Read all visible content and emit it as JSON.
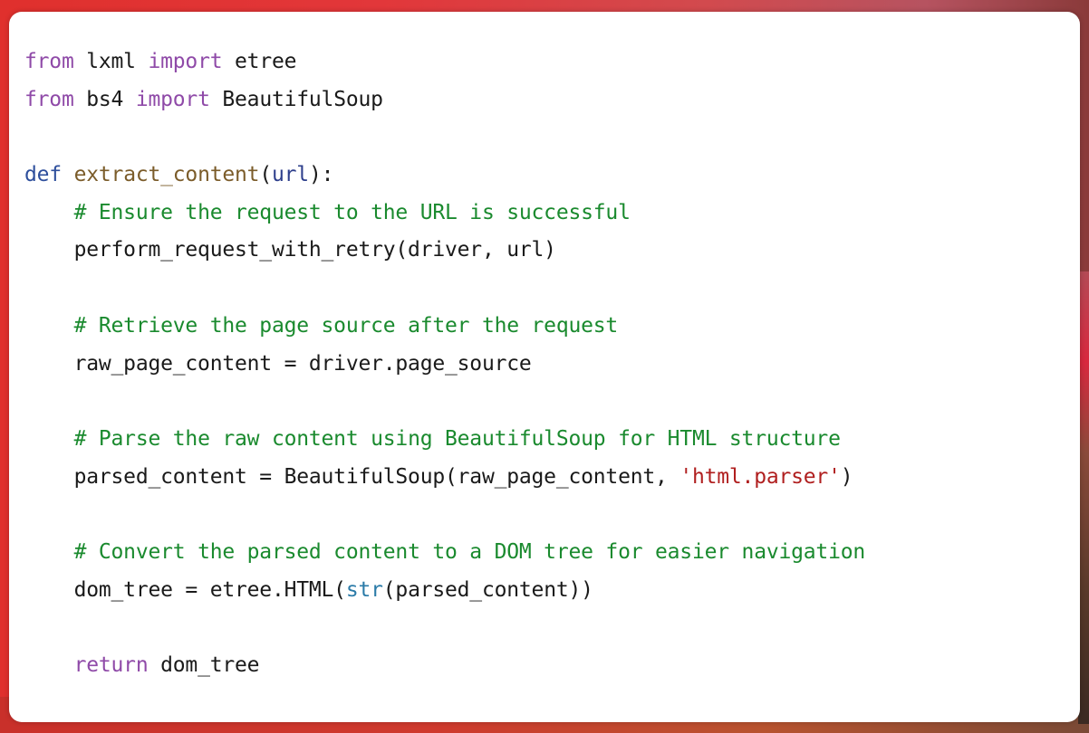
{
  "colors": {
    "keyword": "#8f4aa8",
    "def_keyword": "#2e4f9c",
    "function_name": "#7b5c2a",
    "parameter": "#2e3f8c",
    "comment": "#1a8a2e",
    "string": "#b01f1f",
    "builtin": "#2b7ba8",
    "text": "#1a1a1a",
    "card_background": "#ffffff",
    "page_background": "#e0302d"
  },
  "code": {
    "language": "python",
    "lines": [
      {
        "tokens": [
          {
            "t": "kw",
            "v": "from"
          },
          {
            "t": "plain",
            "v": " lxml "
          },
          {
            "t": "kw",
            "v": "import"
          },
          {
            "t": "plain",
            "v": " etree"
          }
        ]
      },
      {
        "tokens": [
          {
            "t": "kw",
            "v": "from"
          },
          {
            "t": "plain",
            "v": " bs4 "
          },
          {
            "t": "kw",
            "v": "import"
          },
          {
            "t": "plain",
            "v": " BeautifulSoup"
          }
        ]
      },
      {
        "tokens": []
      },
      {
        "tokens": [
          {
            "t": "def",
            "v": "def"
          },
          {
            "t": "plain",
            "v": " "
          },
          {
            "t": "fn",
            "v": "extract_content"
          },
          {
            "t": "plain",
            "v": "("
          },
          {
            "t": "param",
            "v": "url"
          },
          {
            "t": "plain",
            "v": "):"
          }
        ]
      },
      {
        "tokens": [
          {
            "t": "plain",
            "v": "    "
          },
          {
            "t": "cm",
            "v": "# Ensure the request to the URL is successful"
          }
        ]
      },
      {
        "tokens": [
          {
            "t": "plain",
            "v": "    perform_request_with_retry(driver, url)"
          }
        ]
      },
      {
        "tokens": []
      },
      {
        "tokens": [
          {
            "t": "plain",
            "v": "    "
          },
          {
            "t": "cm",
            "v": "# Retrieve the page source after the request"
          }
        ]
      },
      {
        "tokens": [
          {
            "t": "plain",
            "v": "    raw_page_content = driver.page_source"
          }
        ]
      },
      {
        "tokens": []
      },
      {
        "tokens": [
          {
            "t": "plain",
            "v": "    "
          },
          {
            "t": "cm",
            "v": "# Parse the raw content using BeautifulSoup for HTML structure"
          }
        ]
      },
      {
        "tokens": [
          {
            "t": "plain",
            "v": "    parsed_content = BeautifulSoup(raw_page_content, "
          },
          {
            "t": "str",
            "v": "'html.parser'"
          },
          {
            "t": "plain",
            "v": ")"
          }
        ]
      },
      {
        "tokens": []
      },
      {
        "tokens": [
          {
            "t": "plain",
            "v": "    "
          },
          {
            "t": "cm",
            "v": "# Convert the parsed content to a DOM tree for easier navigation"
          }
        ]
      },
      {
        "tokens": [
          {
            "t": "plain",
            "v": "    dom_tree = etree.HTML("
          },
          {
            "t": "bi",
            "v": "str"
          },
          {
            "t": "plain",
            "v": "(parsed_content))"
          }
        ]
      },
      {
        "tokens": []
      },
      {
        "tokens": [
          {
            "t": "plain",
            "v": "    "
          },
          {
            "t": "kw",
            "v": "return"
          },
          {
            "t": "plain",
            "v": " dom_tree"
          }
        ]
      }
    ]
  }
}
